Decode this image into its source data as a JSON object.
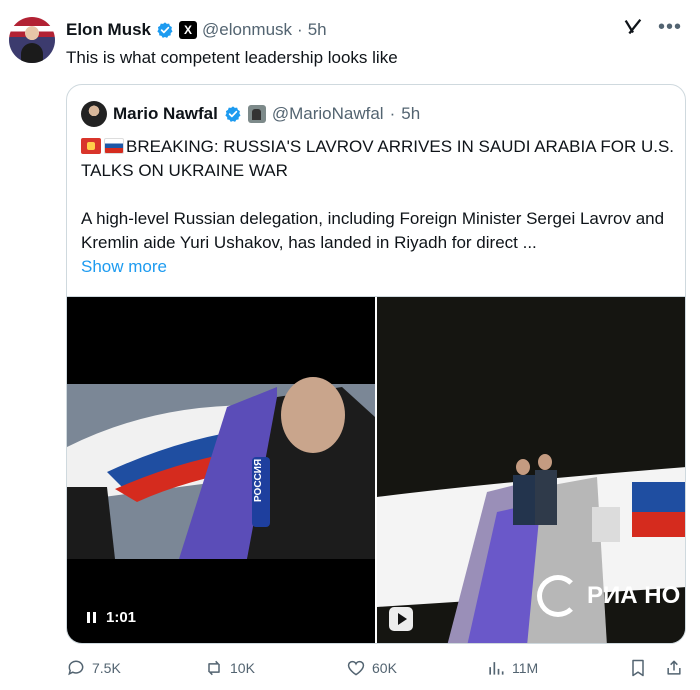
{
  "tweet": {
    "author_name": "Elon Musk",
    "handle": "@elonmusk",
    "separator": "·",
    "time": "5h",
    "text": "This is what competent leadership looks like",
    "x_badge": "X"
  },
  "quote": {
    "author_name": "Mario Nawfal",
    "handle": "@MarioNawfal",
    "separator": "·",
    "time": "5h",
    "headline": "BREAKING: RUSSIA'S LAVROV ARRIVES IN SAUDI ARABIA FOR U.S. TALKS ON UKRAINE WAR",
    "body": "A high-level Russian delegation, including Foreign Minister Sergei Lavrov and Kremlin aide Yuri Ushakov, has landed in Riyadh for direct ...",
    "show_more": "Show more",
    "video_time": "1:01",
    "overlay_text_left": "РОССИЯ",
    "overlay_text_right": "РИА НО"
  },
  "actions": {
    "replies": "7.5K",
    "reposts": "10K",
    "likes": "60K",
    "views": "11M"
  },
  "colors": {
    "accent": "#1d9bf0",
    "text": "#0f1419",
    "muted": "#536471",
    "border": "#cfd9de"
  }
}
